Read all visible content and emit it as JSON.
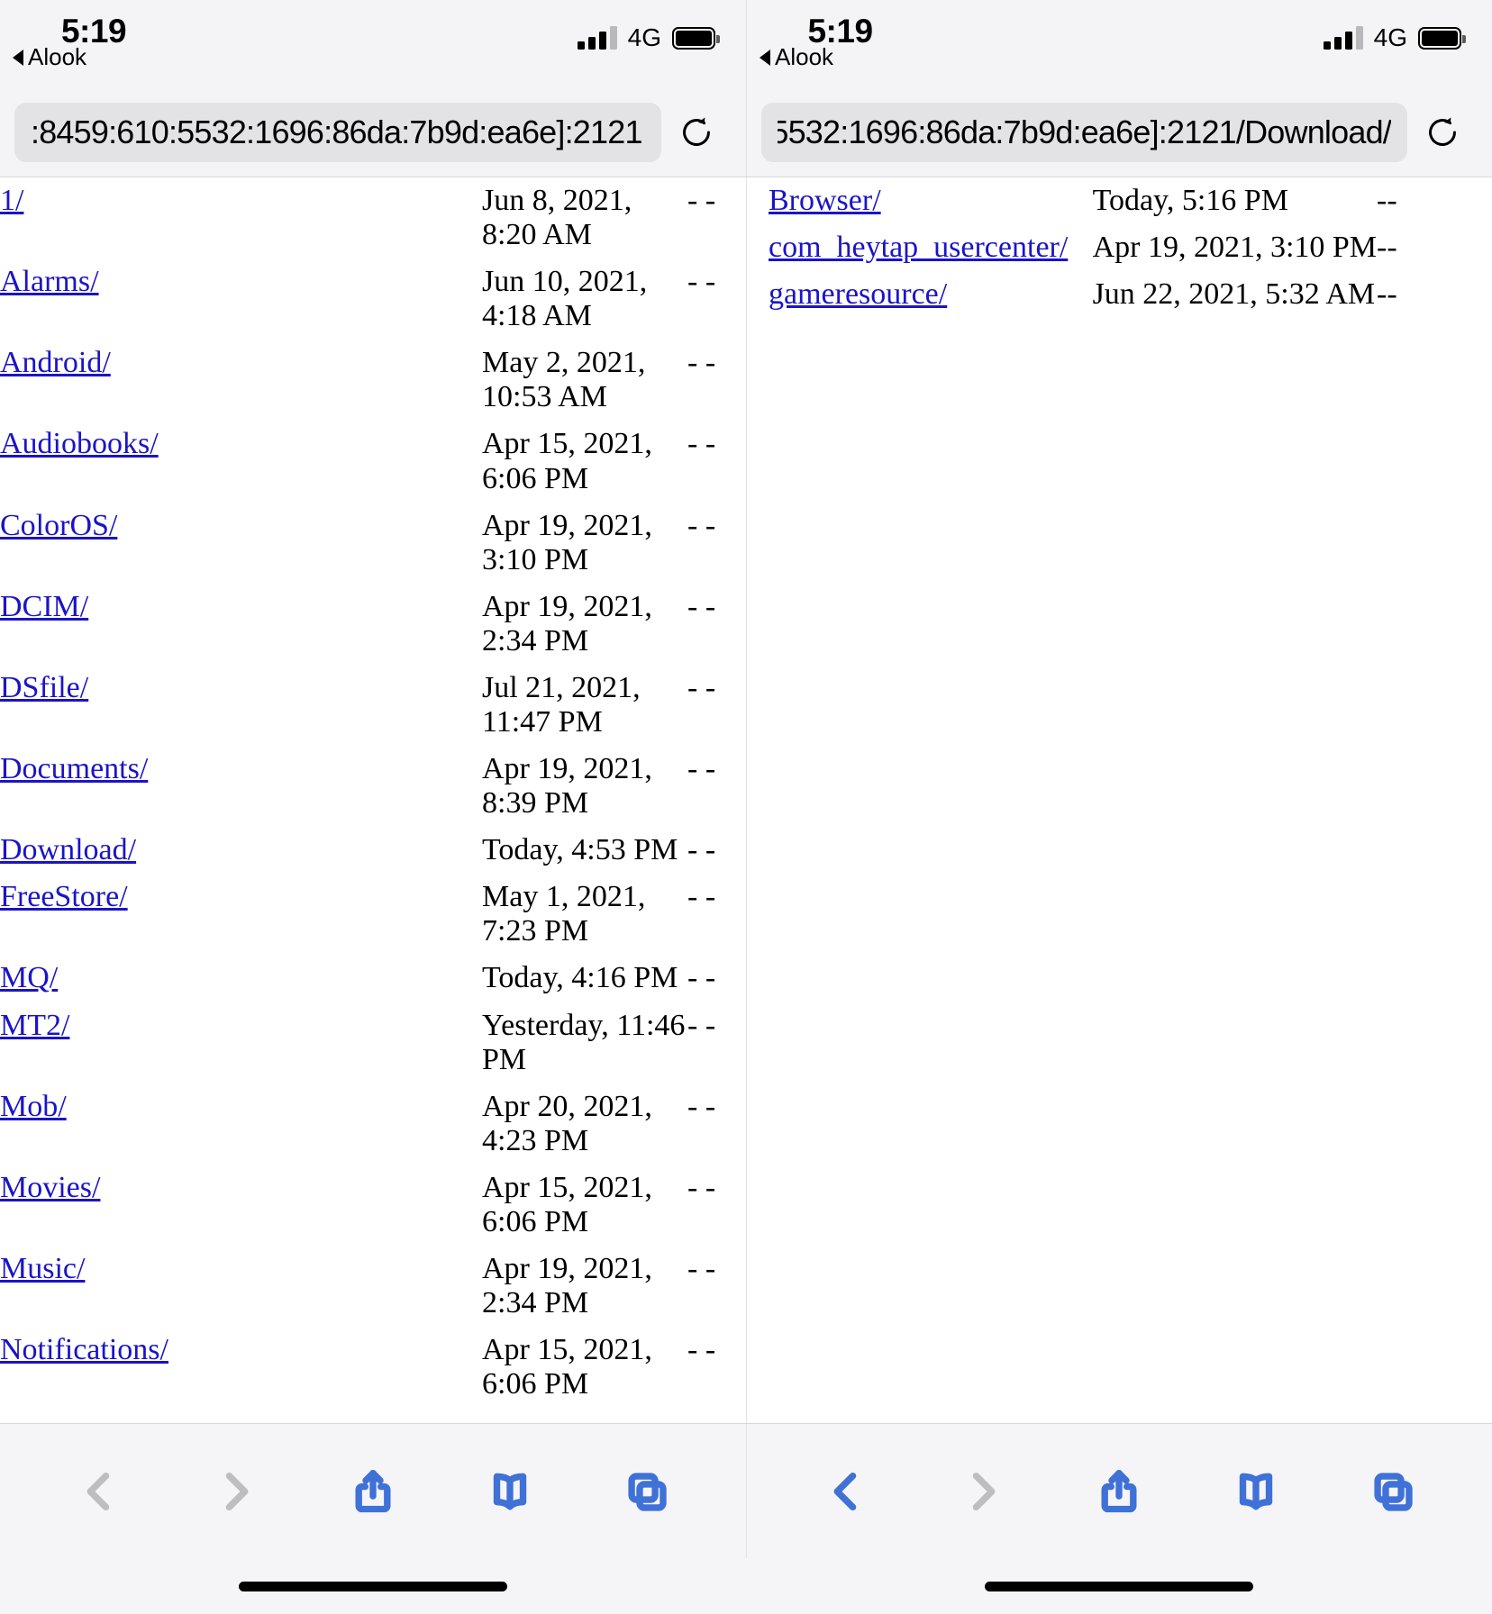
{
  "panes": [
    {
      "id": "left",
      "status": {
        "time": "5:19",
        "back_app": "Alook",
        "network": "4G",
        "signal_bars_filled": 3,
        "signal_bars_total": 4,
        "battery_full": true
      },
      "url": ":8459:610:5532:1696:86da:7b9d:ea6e]:2121",
      "reload_icon": "reload-icon",
      "listing": {
        "rows": [
          {
            "name": "1/",
            "date": "Jun 8, 2021, 8:20 AM",
            "size": "-\n-"
          },
          {
            "name": "Alarms/",
            "date": "Jun 10, 2021, 4:18 AM",
            "size": "-\n-"
          },
          {
            "name": "Android/",
            "date": "May 2, 2021, 10:53 AM",
            "size": "-\n-"
          },
          {
            "name": "Audiobooks/",
            "date": "Apr 15, 2021, 6:06 PM",
            "size": "-\n-"
          },
          {
            "name": "ColorOS/",
            "date": "Apr 19, 2021, 3:10 PM",
            "size": "-\n-"
          },
          {
            "name": "DCIM/",
            "date": "Apr 19, 2021, 2:34 PM",
            "size": "-\n-"
          },
          {
            "name": "DSfile/",
            "date": "Jul 21, 2021, 11:47 PM",
            "size": "-\n-"
          },
          {
            "name": "Documents/",
            "date": "Apr 19, 2021, 8:39 PM",
            "size": "-\n-"
          },
          {
            "name": "Download/",
            "date": "Today, 4:53 PM",
            "size": "-\n-"
          },
          {
            "name": "FreeStore/",
            "date": "May 1, 2021, 7:23 PM",
            "size": "-\n-"
          },
          {
            "name": "MQ/",
            "date": "Today, 4:16 PM",
            "size": "-\n-"
          },
          {
            "name": "MT2/",
            "date": "Yesterday, 11:46 PM",
            "size": "-\n-"
          },
          {
            "name": "Mob/",
            "date": "Apr 20, 2021, 4:23 PM",
            "size": "-\n-"
          },
          {
            "name": "Movies/",
            "date": "Apr 15, 2021, 6:06 PM",
            "size": "-\n-"
          },
          {
            "name": "Music/",
            "date": "Apr 19, 2021, 2:34 PM",
            "size": "-\n-"
          },
          {
            "name": "Notifications/",
            "date": "Apr 15, 2021, 6:06 PM",
            "size": "-\n-"
          }
        ]
      },
      "toolbar": {
        "back": {
          "label": "Back",
          "enabled": false
        },
        "forward": {
          "label": "Forward",
          "enabled": false
        },
        "share": {
          "label": "Share",
          "enabled": true
        },
        "bookmarks": {
          "label": "Bookmarks",
          "enabled": true
        },
        "tabs": {
          "label": "Tabs",
          "enabled": true
        }
      }
    },
    {
      "id": "right",
      "status": {
        "time": "5:19",
        "back_app": "Alook",
        "network": "4G",
        "signal_bars_filled": 3,
        "signal_bars_total": 4,
        "battery_full": true
      },
      "url": "5532:1696:86da:7b9d:ea6e]:2121/Download/",
      "reload_icon": "reload-icon",
      "listing": {
        "rows": [
          {
            "name": "Browser/",
            "date": "Today, 5:16 PM",
            "size": "--"
          },
          {
            "name": "com_heytap_usercenter/",
            "date": "Apr 19, 2021, 3:10 PM",
            "size": "--"
          },
          {
            "name": "gameresource/",
            "date": "Jun 22, 2021, 5:32 AM",
            "size": "--"
          }
        ]
      },
      "toolbar": {
        "back": {
          "label": "Back",
          "enabled": true
        },
        "forward": {
          "label": "Forward",
          "enabled": false
        },
        "share": {
          "label": "Share",
          "enabled": true
        },
        "bookmarks": {
          "label": "Bookmarks",
          "enabled": true
        },
        "tabs": {
          "label": "Tabs",
          "enabled": true
        }
      }
    }
  ],
  "colors": {
    "link": "#1a14c8",
    "accent": "#3f71d7",
    "disabled": "#bdbdc2",
    "chrome_bg": "#f4f4f6",
    "urlfield_bg": "#e3e3e5"
  }
}
